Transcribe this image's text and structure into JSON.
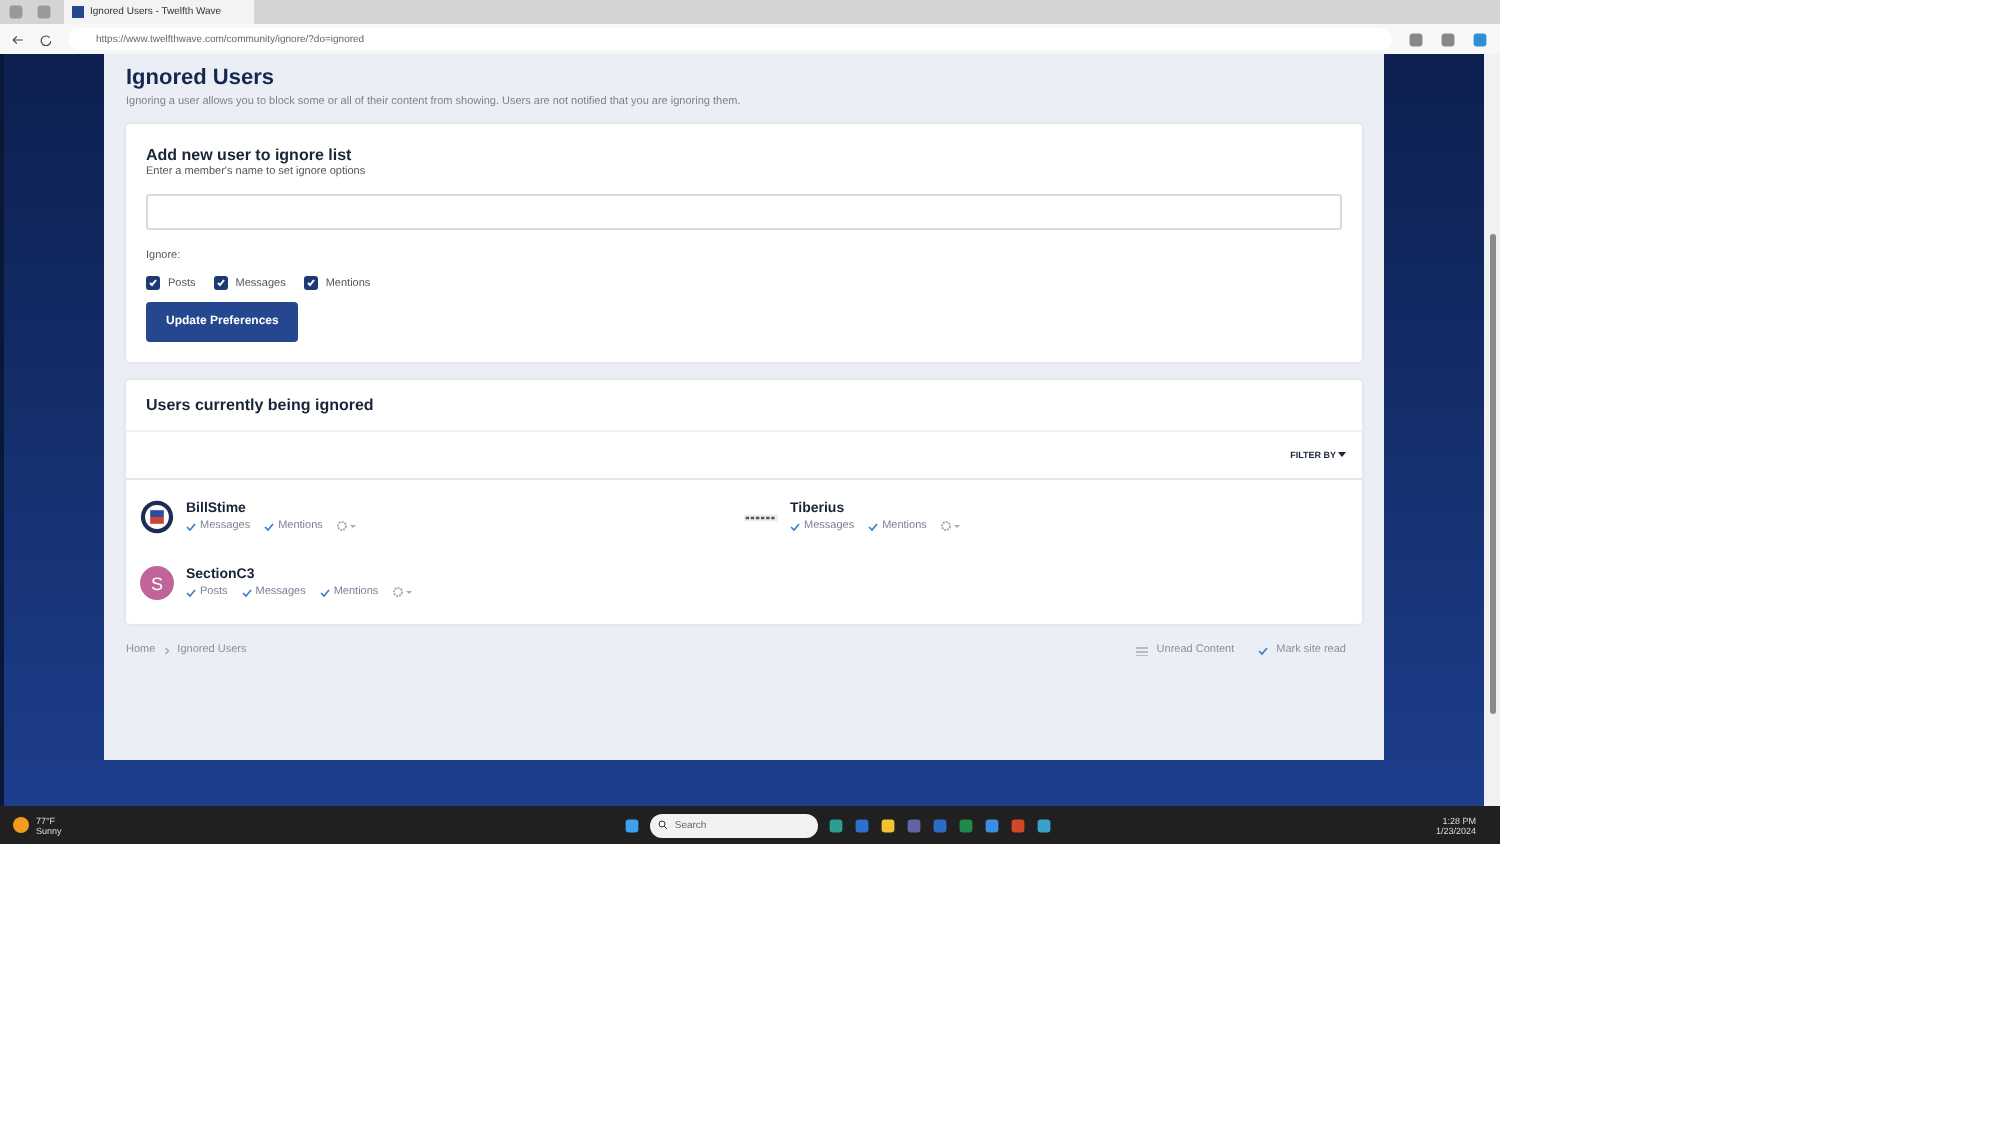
{
  "browser": {
    "tab_title": "Ignored Users - Twelfth Wave",
    "url": "https://www.twelfthwave.com/community/ignore/?do=ignored"
  },
  "page": {
    "title": "Ignored Users",
    "description": "Ignoring a user allows you to block some or all of their content from showing. Users are not notified that you are ignoring them."
  },
  "add_card": {
    "title": "Add new user to ignore list",
    "hint": "Enter a member's name to set ignore options",
    "ignore_label": "Ignore:",
    "options": [
      {
        "label": "Posts",
        "checked": true
      },
      {
        "label": "Messages",
        "checked": true
      },
      {
        "label": "Mentions",
        "checked": true
      }
    ],
    "button": "Update Preferences"
  },
  "ignored_card": {
    "title": "Users currently being ignored",
    "filter": "FILTER BY",
    "users": [
      {
        "name": "BillStime",
        "kind": "seal",
        "options": [
          "Messages",
          "Mentions"
        ]
      },
      {
        "name": "Tiberius",
        "kind": "logo",
        "options": [
          "Messages",
          "Mentions"
        ]
      },
      {
        "name": "SectionC3",
        "kind": "letter",
        "initial": "S",
        "color": "#c0649a",
        "options": [
          "Posts",
          "Messages",
          "Mentions"
        ]
      }
    ]
  },
  "breadcrumb": [
    "Home",
    "Ignored Users"
  ],
  "footer_links": [
    "Unread Content",
    "Mark site read"
  ],
  "taskbar": {
    "temperature": "77°F",
    "weather": "Sunny",
    "search_placeholder": "Search",
    "time": "1:28 PM",
    "date": "1/23/2024"
  }
}
